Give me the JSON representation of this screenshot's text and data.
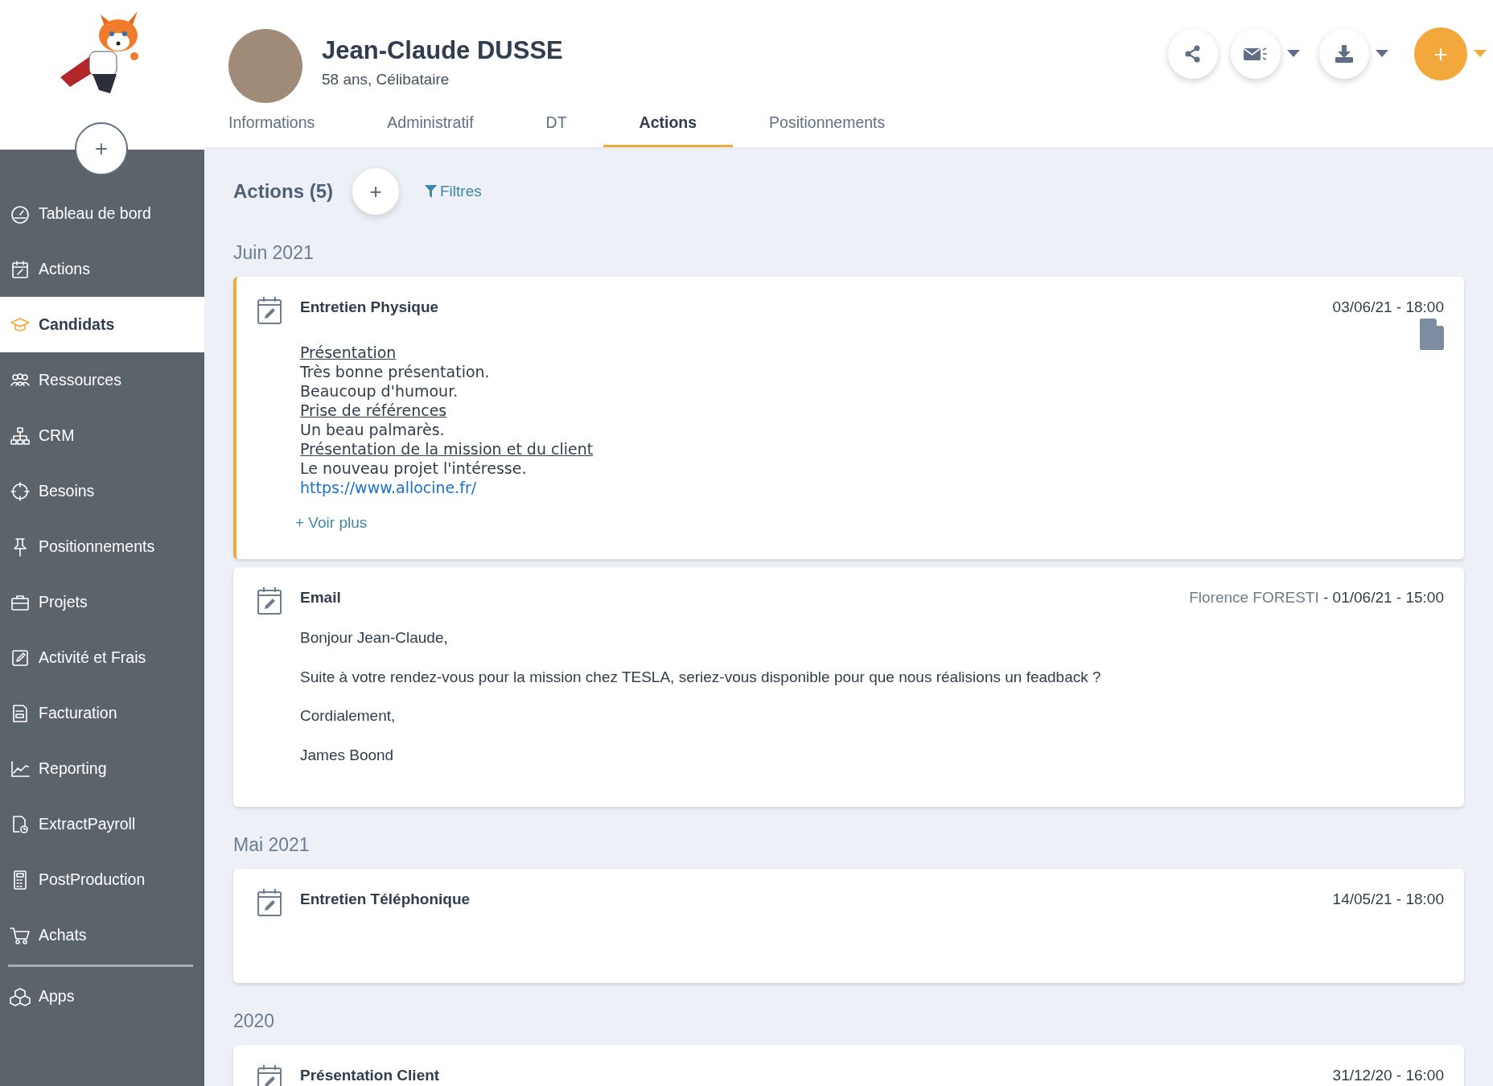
{
  "sidebar": {
    "add_button": "+",
    "items": [
      {
        "label": "Tableau de bord",
        "selected": false
      },
      {
        "label": "Actions",
        "selected": false
      },
      {
        "label": "Candidats",
        "selected": true
      },
      {
        "label": "Ressources",
        "selected": false
      },
      {
        "label": "CRM",
        "selected": false
      },
      {
        "label": "Besoins",
        "selected": false
      },
      {
        "label": "Positionnements",
        "selected": false
      },
      {
        "label": "Projets",
        "selected": false
      },
      {
        "label": "Activité et Frais",
        "selected": false
      },
      {
        "label": "Facturation",
        "selected": false
      },
      {
        "label": "Reporting",
        "selected": false
      },
      {
        "label": "ExtractPayroll",
        "selected": false
      },
      {
        "label": "PostProduction",
        "selected": false
      },
      {
        "label": "Achats",
        "selected": false
      },
      {
        "label": "Apps",
        "selected": false
      }
    ]
  },
  "profile": {
    "name": "Jean-Claude DUSSE",
    "subtitle": "58 ans, Célibataire",
    "add_button": "+"
  },
  "tabs": [
    {
      "label": "Informations",
      "selected": false
    },
    {
      "label": "Administratif",
      "selected": false
    },
    {
      "label": "DT",
      "selected": false
    },
    {
      "label": "Actions",
      "selected": true
    },
    {
      "label": "Positionnements",
      "selected": false
    }
  ],
  "toolbar": {
    "title": "Actions (5)",
    "add_button": "+",
    "filter": "Filtres"
  },
  "groups": [
    {
      "title": "Juin 2021",
      "actions": [
        {
          "kind": "note",
          "title": "Entretien Physique",
          "date": "03/06/21 - 18:00",
          "selected": true,
          "attachment": true,
          "more": "+ Voir plus",
          "lines": [
            {
              "kind": "heading",
              "text": "Présentation"
            },
            {
              "kind": "text",
              "text": "Très bonne présentation."
            },
            {
              "kind": "text",
              "text": "Beaucoup d'humour."
            },
            {
              "kind": "heading",
              "text": "Prise de références"
            },
            {
              "kind": "text",
              "text": "Un beau palmarès."
            },
            {
              "kind": "heading",
              "text": "Présentation de la mission et du client"
            },
            {
              "kind": "text",
              "text": "Le nouveau projet l'intéresse."
            },
            {
              "kind": "link",
              "text": "https://www.allocine.fr/"
            }
          ]
        },
        {
          "kind": "email",
          "title": "Email",
          "author": "Florence FORESTI",
          "separator": "-",
          "date": "01/06/21 - 15:00",
          "selected": false,
          "paragraphs": [
            "Bonjour Jean-Claude,",
            "Suite à votre rendez-vous pour la mission chez TESLA, seriez-vous disponible pour que nous réalisions un feadback ?",
            "Cordialement,",
            "James Boond"
          ]
        }
      ]
    },
    {
      "title": "Mai 2021",
      "actions": [
        {
          "kind": "event",
          "title": "Entretien Téléphonique",
          "date": "14/05/21 - 18:00",
          "selected": false
        }
      ]
    },
    {
      "title": "2020",
      "actions": [
        {
          "kind": "event",
          "title": "Présentation Client",
          "date": "31/12/20 - 16:00",
          "selected": false
        }
      ]
    }
  ]
}
